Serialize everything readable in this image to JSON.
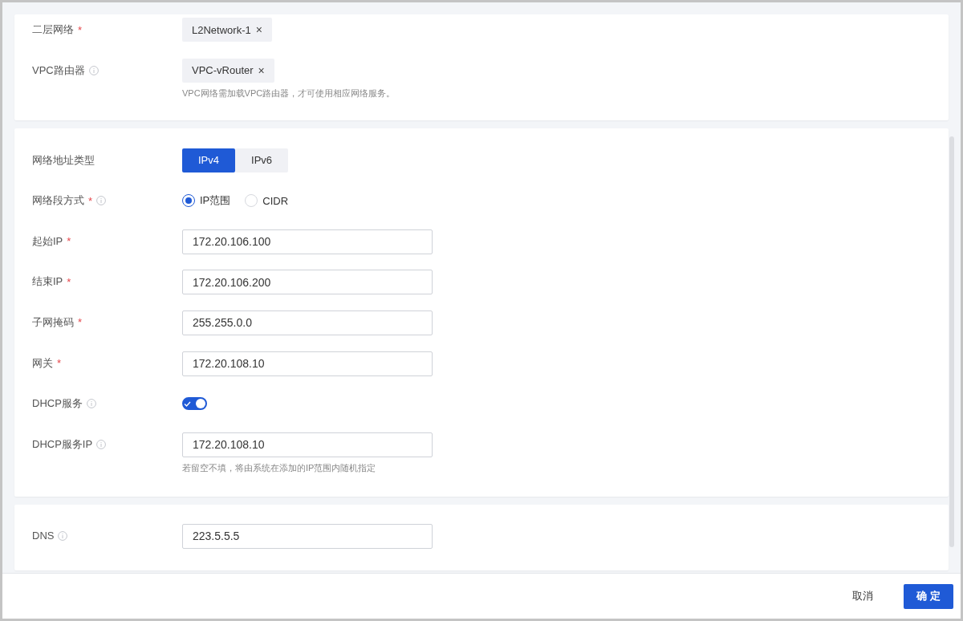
{
  "sections": [
    {
      "fields": [
        {
          "kind": "tags",
          "label": "二层网络",
          "required_mark": "*",
          "info": false,
          "tags": [
            {
              "text": "L2Network-1",
              "remove": "×"
            }
          ]
        },
        {
          "kind": "tags",
          "label": "VPC路由器",
          "info": true,
          "tags": [
            {
              "text": "VPC-vRouter",
              "remove": "×"
            }
          ],
          "hint": "VPC网络需加载VPC路由器，才可使用相应网络服务。"
        }
      ]
    },
    {
      "fields": [
        {
          "kind": "segmented",
          "label": "网络地址类型",
          "info": false,
          "options": [
            {
              "text": "IPv4",
              "selected": true
            },
            {
              "text": "IPv6",
              "selected": false
            }
          ]
        },
        {
          "kind": "radio",
          "label": "网络段方式",
          "required_mark": "*",
          "info": true,
          "options": [
            {
              "text": "IP范围",
              "selected": true
            },
            {
              "text": "CIDR",
              "selected": false
            }
          ]
        },
        {
          "kind": "input",
          "label": "起始IP",
          "required_mark": "*",
          "info": false,
          "value": "172.20.106.100"
        },
        {
          "kind": "input",
          "label": "结束IP",
          "required_mark": "*",
          "info": false,
          "value": "172.20.106.200"
        },
        {
          "kind": "input",
          "label": "子网掩码",
          "required_mark": "*",
          "info": false,
          "value": "255.255.0.0"
        },
        {
          "kind": "input",
          "label": "网关",
          "required_mark": "*",
          "info": false,
          "value": "172.20.108.10"
        },
        {
          "kind": "switch",
          "label": "DHCP服务",
          "info": true,
          "on": true
        },
        {
          "kind": "input",
          "label": "DHCP服务IP",
          "info": true,
          "value": "172.20.108.10",
          "hint": "若留空不填，将由系统在添加的IP范围内随机指定"
        }
      ]
    },
    {
      "fields": [
        {
          "kind": "input",
          "label": "DNS",
          "info": true,
          "value": "223.5.5.5"
        }
      ]
    }
  ],
  "footer": {
    "buttons": [
      {
        "text": "取消",
        "kind": "secondary"
      },
      {
        "text": "确 定",
        "kind": "primary"
      }
    ]
  }
}
